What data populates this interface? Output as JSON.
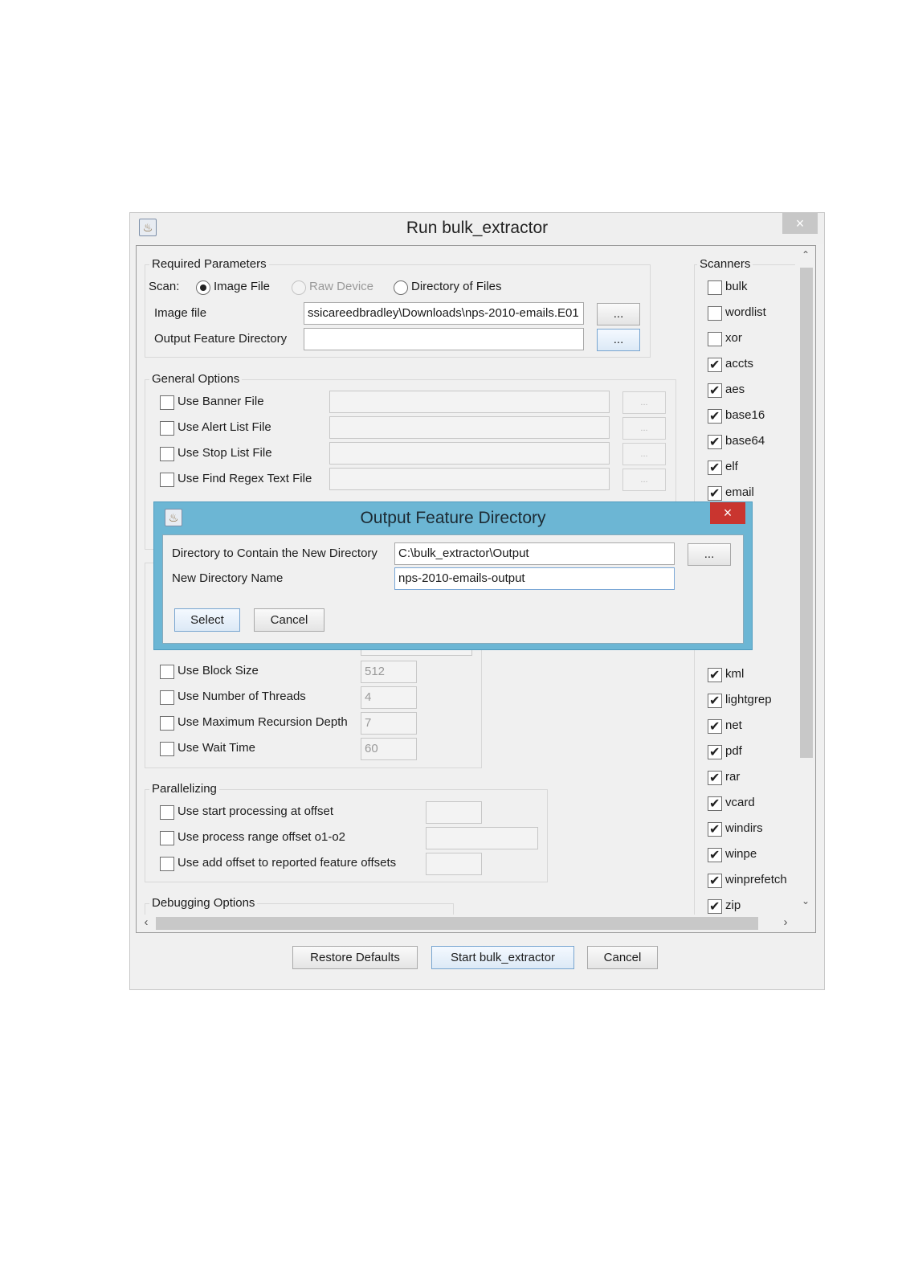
{
  "window": {
    "title": "Run bulk_extractor",
    "close_glyph": "×",
    "icon": "java-icon"
  },
  "required": {
    "legend": "Required Parameters",
    "scan_label": "Scan:",
    "scan_options": [
      "Image File",
      "Raw Device",
      "Directory of Files"
    ],
    "scan_selected": "Image File",
    "image_file_label": "Image file",
    "image_file_value": "ssicareedbradley\\Downloads\\nps-2010-emails.E01",
    "output_dir_label": "Output Feature Directory",
    "output_dir_value": "",
    "browse": "..."
  },
  "general": {
    "legend": "General Options",
    "items": [
      "Use Banner File",
      "Use Alert List File",
      "Use Stop List File",
      "Use Find Regex Text File"
    ]
  },
  "tuning": {
    "items": [
      {
        "label": "Use Block Size",
        "value": "512"
      },
      {
        "label": "Use Number of Threads",
        "value": "4"
      },
      {
        "label": "Use Maximum Recursion Depth",
        "value": "7"
      },
      {
        "label": "Use Wait Time",
        "value": "60"
      }
    ]
  },
  "parallel": {
    "legend": "Parallelizing",
    "items": [
      "Use start processing at offset",
      "Use process range offset o1-o2",
      "Use add offset to reported feature offsets"
    ]
  },
  "debugging": {
    "legend": "Debugging Options"
  },
  "scanners": {
    "legend": "Scanners",
    "top": [
      {
        "name": "bulk",
        "checked": false
      },
      {
        "name": "wordlist",
        "checked": false
      },
      {
        "name": "xor",
        "checked": false
      },
      {
        "name": "accts",
        "checked": true
      },
      {
        "name": "aes",
        "checked": true
      },
      {
        "name": "base16",
        "checked": true
      },
      {
        "name": "base64",
        "checked": true
      },
      {
        "name": "elf",
        "checked": true
      },
      {
        "name": "email",
        "checked": true
      }
    ],
    "bottom": [
      {
        "name": "kml",
        "checked": true
      },
      {
        "name": "lightgrep",
        "checked": true
      },
      {
        "name": "net",
        "checked": true
      },
      {
        "name": "pdf",
        "checked": true
      },
      {
        "name": "rar",
        "checked": true
      },
      {
        "name": "vcard",
        "checked": true
      },
      {
        "name": "windirs",
        "checked": true
      },
      {
        "name": "winpe",
        "checked": true
      },
      {
        "name": "winprefetch",
        "checked": true
      },
      {
        "name": "zip",
        "checked": true
      }
    ]
  },
  "scrollbar": {
    "up": "^",
    "down": "v",
    "left": "<",
    "right": ">"
  },
  "footer": {
    "restore": "Restore Defaults",
    "start": "Start bulk_extractor",
    "cancel": "Cancel"
  },
  "dialog": {
    "title": "Output Feature Directory",
    "close_glyph": "×",
    "parent_label": "Directory to Contain the New Directory",
    "parent_value": "C:\\bulk_extractor\\Output",
    "name_label": "New Directory Name",
    "name_value": "nps-2010-emails-output",
    "browse": "...",
    "select": "Select",
    "cancel": "Cancel"
  }
}
